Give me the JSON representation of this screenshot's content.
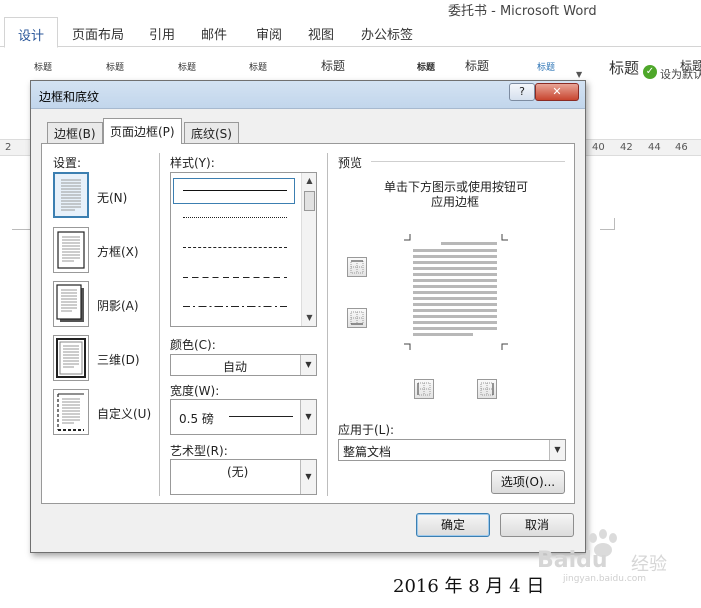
{
  "word": {
    "window_title": "委托书 - Microsoft Word",
    "ribbon_tabs": [
      "设计",
      "页面布局",
      "引用",
      "邮件",
      "审阅",
      "视图",
      "办公标签"
    ],
    "style_gallery": [
      "标题",
      "标题",
      "标题",
      "标题",
      "标题",
      "标题",
      "标题",
      "标题",
      "标题",
      "标题"
    ],
    "style_tail": "标题",
    "set_default_text": "设为默认",
    "ruler_numbers": [
      "2",
      "40",
      "42",
      "44",
      "46"
    ],
    "document_date": "2016 年 8 月 4 日"
  },
  "dialog": {
    "title": "边框和底纹",
    "help_label": "?",
    "close_label": "✕",
    "tabs": [
      "边框(B)",
      "页面边框(P)",
      "底纹(S)"
    ],
    "settings": {
      "label": "设置:",
      "items": [
        "无(N)",
        "方框(X)",
        "阴影(A)",
        "三维(D)",
        "自定义(U)"
      ]
    },
    "style": {
      "label": "样式(Y):",
      "color_label": "颜色(C):",
      "color_value": "自动",
      "width_label": "宽度(W):",
      "width_value": "0.5 磅",
      "art_label": "艺术型(R):",
      "art_value": "(无)"
    },
    "preview": {
      "label": "预览",
      "hint_line1": "单击下方图示或使用按钮可",
      "hint_line2": "应用边框",
      "apply_label": "应用于(L):",
      "apply_value": "整篇文档",
      "options_button": "选项(O)..."
    },
    "ok_button": "确定",
    "cancel_button": "取消"
  },
  "watermark": {
    "brand": "Baidu",
    "sub": "经验",
    "url": "jingyan.baidu.com"
  }
}
